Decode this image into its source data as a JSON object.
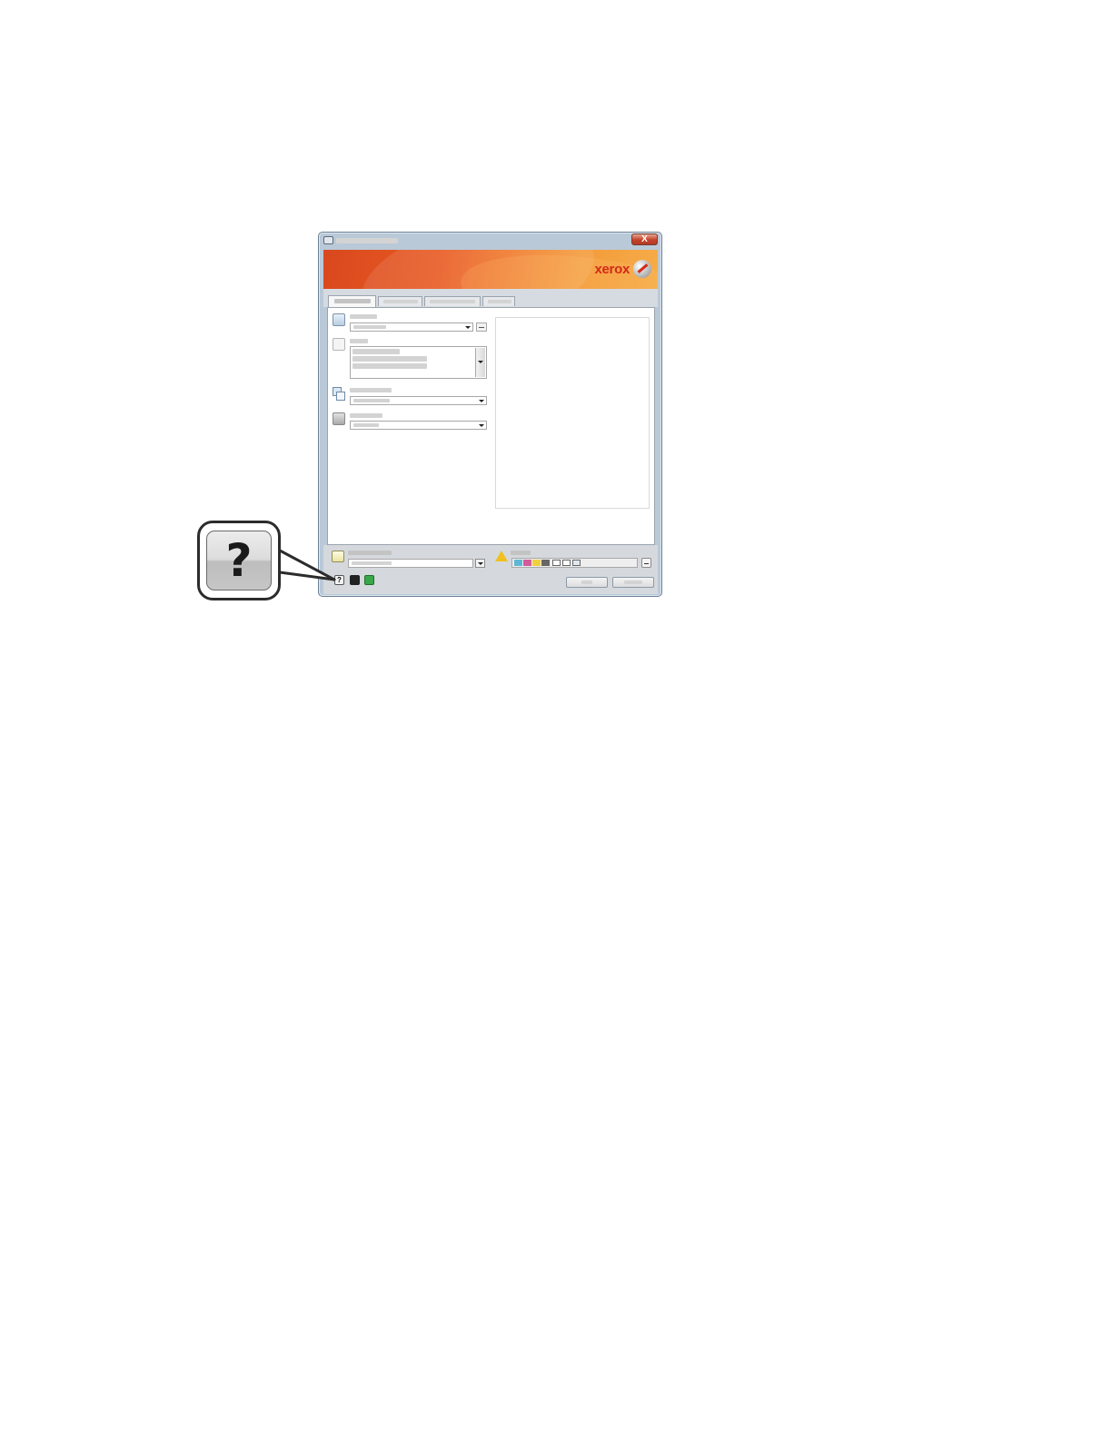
{
  "window": {
    "close_label": "X"
  },
  "banner": {
    "brand_wordmark": "xerox",
    "brand_color": "#d32a1a",
    "gradient_colors": [
      "#d9481e",
      "#f6ac48"
    ]
  },
  "callout": {
    "symbol": "?"
  },
  "bottom_bar": {
    "help_symbol": "?"
  },
  "icons": {
    "callout": "help-question-icon",
    "window": "printer-icon"
  }
}
